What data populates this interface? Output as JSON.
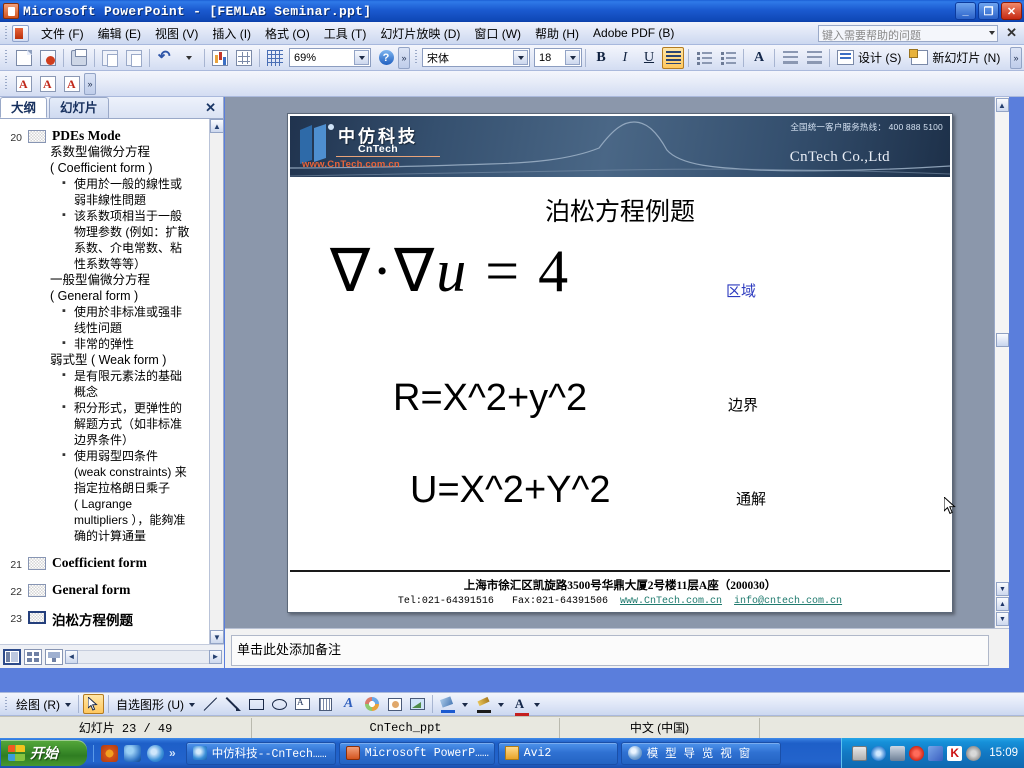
{
  "window": {
    "title": "Microsoft PowerPoint - [FEMLAB Seminar.ppt]",
    "minimize_label": "_",
    "restore_label": "❐",
    "close_label": "✕"
  },
  "menu": {
    "items": [
      "文件 (F)",
      "编辑 (E)",
      "视图 (V)",
      "插入 (I)",
      "格式 (O)",
      "工具 (T)",
      "幻灯片放映 (D)",
      "窗口 (W)",
      "帮助 (H)",
      "Adobe PDF (B)"
    ],
    "ask_placeholder": "键入需要帮助的问题",
    "close_label": "✕"
  },
  "toolbar": {
    "zoom_value": "69%",
    "font_name": "宋体",
    "font_size": "18",
    "bold_label": "B",
    "italic_label": "I",
    "underline_label": "U",
    "bigA_label": "A",
    "design_label": "设计 (S)",
    "newslide_label": "新幻灯片 (N)",
    "overflow_label": "»"
  },
  "outline": {
    "tab_outline": "大纲",
    "tab_slides": "幻灯片",
    "close_label": "✕",
    "current_slide": {
      "number": "20",
      "title": "PDEs Mode",
      "lines": [
        {
          "level": 1,
          "text": "系数型偏微分方程"
        },
        {
          "level": 1,
          "text": "( Coefficient form )"
        },
        {
          "level": 2,
          "text": "使用於一般的線性或"
        },
        {
          "level": 2,
          "text": "弱非線性問題",
          "cont": true
        },
        {
          "level": 2,
          "text": "该系数项相当于一般"
        },
        {
          "level": 2,
          "text": "物理参数 (例如：扩散",
          "cont": true
        },
        {
          "level": 2,
          "text": "系数、介电常数、粘",
          "cont": true
        },
        {
          "level": 2,
          "text": "性系数等等）",
          "cont": true
        },
        {
          "level": 1,
          "text": "一般型偏微分方程"
        },
        {
          "level": 1,
          "text": "( General form )"
        },
        {
          "level": 2,
          "text": "使用於非标准或强非"
        },
        {
          "level": 2,
          "text": "线性问題",
          "cont": true
        },
        {
          "level": 2,
          "text": "非常的弹性"
        },
        {
          "level": 1,
          "text": "弱式型 ( Weak form )"
        },
        {
          "level": 2,
          "text": "是有限元素法的基础"
        },
        {
          "level": 2,
          "text": "概念",
          "cont": true
        },
        {
          "level": 2,
          "text": "积分形式，更弹性的"
        },
        {
          "level": 2,
          "text": "解题方式（如非标准",
          "cont": true
        },
        {
          "level": 2,
          "text": "边界条件）",
          "cont": true
        },
        {
          "level": 2,
          "text": "使用弱型四条件"
        },
        {
          "level": 2,
          "text": "(weak constraints) 来",
          "cont": true
        },
        {
          "level": 2,
          "text": "指定拉格朗日乘子",
          "cont": true
        },
        {
          "level": 2,
          "text": "( Lagrange",
          "cont": true
        },
        {
          "level": 2,
          "text": "multipliers ），能夠准",
          "cont": true
        },
        {
          "level": 2,
          "text": "确的计算通量",
          "cont": true
        }
      ]
    },
    "other_slides": [
      {
        "number": "21",
        "title": "Coefficient form",
        "selected": false
      },
      {
        "number": "22",
        "title": "General form",
        "selected": false
      },
      {
        "number": "23",
        "title": "泊松方程例题",
        "selected": true
      }
    ]
  },
  "slide": {
    "banner": {
      "logo_cn": "中仿科技",
      "logo_en": "CnTech",
      "logo_url": "www.CnTech.com.cn",
      "hotline": "全国统一客户服务热线： 400 888 5100",
      "company": "CnTech Co.,Ltd"
    },
    "title": "泊松方程例题",
    "equation_main_prefix": "∇·∇",
    "equation_main_var": "u",
    "equation_main_suffix": " = 4",
    "equation_r": "R=X^2+y^2",
    "equation_u": "U=X^2+Y^2",
    "tag_region": "区域",
    "tag_boundary": "边界",
    "tag_general": "通解",
    "footer_line1": "上海市徐汇区凯旋路3500号华鼎大厦2号楼11层A座（200030）",
    "footer_tel": "Tel:021-64391516",
    "footer_fax": "Fax:021-64391506",
    "footer_web": "www.CnTech.com.cn",
    "footer_mail": "info@cntech.com.cn"
  },
  "notes": {
    "placeholder_text": "单击此处添加备注"
  },
  "drawbar": {
    "draw_label": "绘图 (R)",
    "autoshapes_label": "自选图形 (U)"
  },
  "status": {
    "slide_counter": "幻灯片 23 / 49",
    "design_name": "CnTech_ppt",
    "language": "中文 (中国)"
  },
  "taskbar": {
    "start_label": "开始",
    "quick_more": "»",
    "tasks": [
      {
        "label": "中仿科技--CnTech……",
        "icon": "ie-icon"
      },
      {
        "label": "Microsoft PowerP……",
        "icon": "powerpoint-icon"
      },
      {
        "label": "Avi2",
        "icon": "folder-icon"
      },
      {
        "label": "模 型 导 览 视 窗",
        "icon": "model-icon"
      }
    ],
    "time": "15:09"
  }
}
